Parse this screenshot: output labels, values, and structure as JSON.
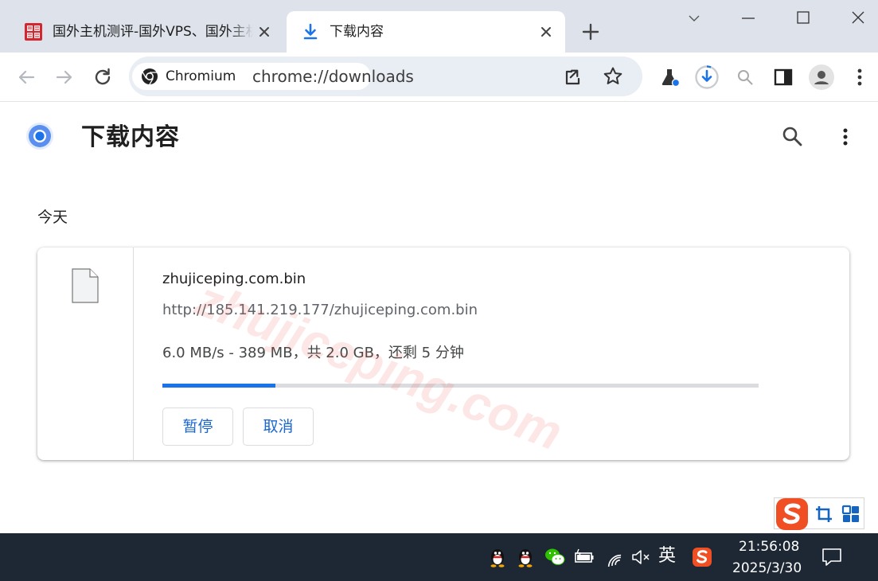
{
  "tabs": [
    {
      "title": "国外主机测评-国外VPS、国外主机",
      "active": false,
      "favicon": "zhujiceping-seal-icon"
    },
    {
      "title": "下载内容",
      "active": true,
      "favicon": "download-icon"
    }
  ],
  "toolbar": {
    "chip_label": "Chromium",
    "url": "chrome://downloads"
  },
  "page": {
    "title": "下载内容",
    "date_group": "今天"
  },
  "download": {
    "file_name": "zhujiceping.com.bin",
    "url": "http://185.141.219.177/zhujiceping.com.bin",
    "status": "6.0 MB/s - 389 MB，共 2.0 GB，还剩 5 分钟",
    "progress": 0.19,
    "pause_label": "暂停",
    "cancel_label": "取消"
  },
  "watermark": "zhujiceping.com",
  "taskbar": {
    "ime_lang": "英",
    "time": "21:56:08",
    "date": "2025/3/30"
  },
  "colors": {
    "accent": "#1a73e8",
    "tabstrip": "#dee3eb",
    "taskbar": "#1e2734",
    "sogou": "#f04e23"
  }
}
